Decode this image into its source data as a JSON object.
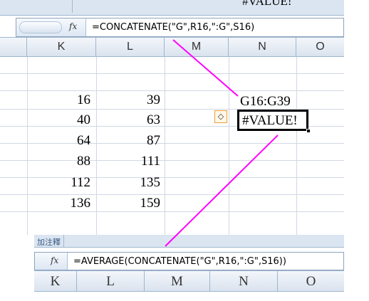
{
  "top_tab_label": "",
  "top_cell_value": "#VALUE!",
  "formula_bar_top": {
    "fx_label": "fx",
    "formula": "=CONCATENATE(\"G\",R16,\":G\",S16)"
  },
  "columns_top": [
    "K",
    "L",
    "M",
    "N",
    "O"
  ],
  "cells": {
    "col_k": [
      "16",
      "40",
      "64",
      "88",
      "112",
      "136"
    ],
    "col_l": [
      "39",
      "63",
      "87",
      "111",
      "135",
      "159"
    ],
    "n_ref": "G16:G39",
    "n_error": "#VALUE!"
  },
  "lower_panel": {
    "tab_label": "加注釋",
    "fx_label": "fx",
    "formula": "=AVERAGE(CONCATENATE(\"G\",R16,\":G\",S16))",
    "columns": [
      "K",
      "L",
      "M",
      "N",
      "O"
    ]
  },
  "colors": {
    "annotation_line": "#ff00ff",
    "header_bg": "#dae3ee",
    "grid_line": "#d0d7e5"
  }
}
